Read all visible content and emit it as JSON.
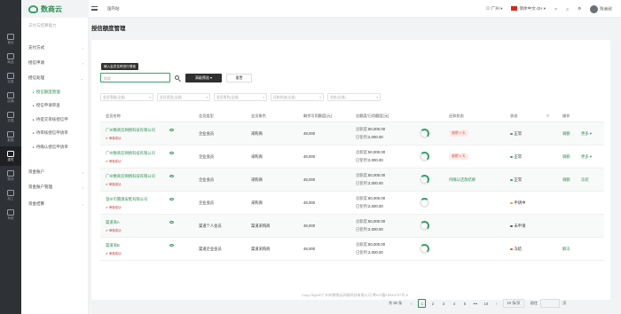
{
  "rail": [
    "首页",
    "商品",
    "交易",
    "店铺",
    "交易",
    "数据",
    "支付",
    "物流",
    "加工",
    "系统"
  ],
  "rail_active_index": 6,
  "logo": {
    "text": "数商云",
    "sub": "SHUSHANGYUN"
  },
  "topbar": {
    "site": "国内站",
    "location": "广州",
    "language": "简体中文-ZH",
    "username": "陈美欣"
  },
  "sidebar": {
    "header": "支付与结算能力",
    "items": [
      {
        "label": "支付方式",
        "type": "group"
      },
      {
        "label": "授信申请",
        "type": "group"
      },
      {
        "label": "授信处理",
        "type": "group"
      },
      {
        "label": "授信额度管理",
        "type": "sub",
        "active": true
      },
      {
        "label": "授信申请审查",
        "type": "sub"
      },
      {
        "label": "待提交审核授信申",
        "type": "sub"
      },
      {
        "label": "待审核授信申请单",
        "type": "sub"
      },
      {
        "label": "待确认授信申请单",
        "type": "sub"
      },
      {
        "label": "资金账户",
        "type": "group"
      },
      {
        "label": "资金账户管理",
        "type": "group"
      },
      {
        "label": "资金结算",
        "type": "group"
      }
    ]
  },
  "page_title": "授信额度管理",
  "tooltip": "输入会员名称进行搜索",
  "search_placeholder": "搜索",
  "buttons": {
    "advanced": "高级筛选 ▾",
    "reset": "重置"
  },
  "filters": [
    "会员等级(全部)",
    "会员类型(全部)",
    "会员角色(全部)",
    "还款状态(全部)",
    "状态(全部)"
  ],
  "columns": [
    "会员名称",
    "会员类型",
    "会员角色",
    "剩余可用额度(元)",
    "总额度/已用额度(元)",
    "还款状态",
    "状态",
    "操作"
  ],
  "rows": [
    {
      "name": "广州数商云网络科技有限公司",
      "tag": "审核成功",
      "type": "企业会员",
      "role": "采购商",
      "remain": "48,000",
      "total_label": "总额度：",
      "total": "50,000.00",
      "used_label": "已使用：",
      "used": "2,000.00",
      "repay": "逾期 3 天",
      "repay_kind": "badge",
      "status": "正常",
      "status_color": "#38a169",
      "actions": [
        "调额",
        "更多 ▾"
      ]
    },
    {
      "name": "广州数商云网络科技有限公司",
      "tag": "审核成功",
      "type": "企业会员",
      "role": "采购商",
      "remain": "48,000",
      "total_label": "总额度：",
      "total": "50,000.00",
      "used_label": "已使用：",
      "used": "2,000.00",
      "repay": "逾期 3 天",
      "repay_kind": "badge",
      "status": "正常",
      "status_color": "#38a169",
      "actions": [
        "调额",
        "更多 ▾"
      ]
    },
    {
      "name": "广州数商云网络科技有限公司",
      "tag": "审核成功",
      "type": "企业会员",
      "role": "采购商",
      "remain": "48,000",
      "total_label": "总额度：",
      "total": "50,000.00",
      "used_label": "已使用：",
      "used": "2,000.00",
      "repay": "待确认还款结果",
      "repay_kind": "link",
      "status": "正常",
      "status_color": "#38a169",
      "actions": [
        "调额",
        "冻结"
      ]
    },
    {
      "name": "温州市腾源皮鞋有限公司",
      "tag": "审核成功",
      "type": "企业会员",
      "role": "采购商",
      "remain": "48,000",
      "total_label": "总额度：",
      "total": "50,000.00",
      "used_label": "已使用：",
      "used": "2,000.00",
      "repay": "",
      "repay_kind": "none",
      "status": "申请中",
      "status_color": "#f0a020",
      "actions": []
    },
    {
      "name": "渠道商A",
      "tag": "审核成功",
      "type": "渠道个人会员",
      "role": "渠道采购商",
      "remain": "48,000",
      "total_label": "总额度：",
      "total": "50,000.00",
      "used_label": "已使用：",
      "used": "2,000.00",
      "repay": "",
      "repay_kind": "none",
      "status": "未申请",
      "status_color": "#555555",
      "actions": []
    },
    {
      "name": "渠道商B",
      "tag": "审核成功",
      "type": "渠道企业会员",
      "role": "渠道采购商",
      "remain": "48,000",
      "total_label": "总额度：",
      "total": "50,000.00",
      "used_label": "已使用：",
      "used": "2,000.00",
      "repay": "",
      "repay_kind": "none",
      "status": "冻结",
      "status_color": "#e74c3c",
      "actions": [
        "解冻"
      ]
    }
  ],
  "pager": {
    "total": "共 60 条",
    "pages": [
      "1",
      "2",
      "3",
      "4",
      "5",
      "•••",
      "10"
    ],
    "current": "1",
    "page_size": "10 条/页",
    "goto": "前往",
    "page_unit": "页"
  },
  "footer": "Copy Right©广州市数商云网络科技有限公司 粤ICP备19044797号-5"
}
